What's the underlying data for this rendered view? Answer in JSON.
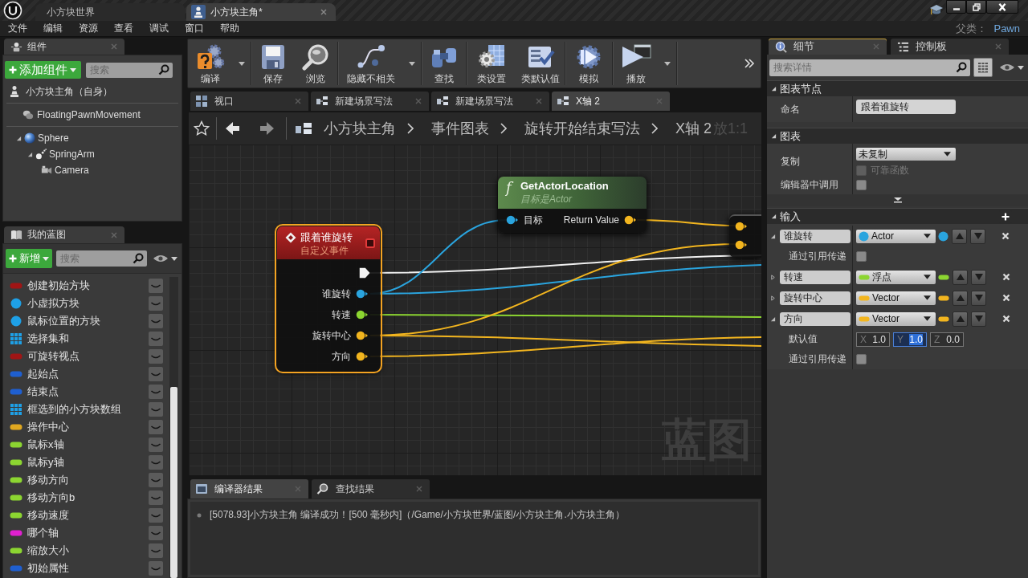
{
  "title_bar": {
    "tabs": [
      {
        "label": "小方块世界",
        "kind": "level",
        "selected": false
      },
      {
        "label": "小方块主角*",
        "kind": "blueprint",
        "selected": true
      }
    ]
  },
  "menu_bar": {
    "items": [
      "文件",
      "编辑",
      "资源",
      "查看",
      "调试",
      "窗口",
      "帮助"
    ],
    "parent_class_label": "父类：",
    "parent_class": "Pawn"
  },
  "components_panel": {
    "tab": "组件",
    "add_button": "添加组件",
    "search": {
      "placeholder": "搜索"
    },
    "root_item": "小方块主角（自身）",
    "components": [
      {
        "label": "FloatingPawnMovement",
        "kind": "movement"
      }
    ],
    "tree": [
      {
        "label": "Sphere",
        "kind": "sphere",
        "expanded": true,
        "children": [
          {
            "label": "SpringArm",
            "kind": "spring_arm",
            "expanded": true,
            "children": [
              {
                "label": "Camera",
                "kind": "camera"
              }
            ]
          }
        ]
      }
    ]
  },
  "my_blueprint_panel": {
    "tab": "我的蓝图",
    "add_button": "新增",
    "search": {
      "placeholder": "搜索"
    },
    "variables": [
      {
        "name": "创建初始方块",
        "kind": "pill",
        "color": "#a01515"
      },
      {
        "name": "小虚拟方块",
        "kind": "sphere",
        "color": "#1ea0e6"
      },
      {
        "name": "鼠标位置的方块",
        "kind": "sphere",
        "color": "#1ea0e6"
      },
      {
        "name": "选择集和",
        "kind": "grid",
        "color": "#1ea0e6"
      },
      {
        "name": "可旋转视点",
        "kind": "pill",
        "color": "#a01515"
      },
      {
        "name": "起始点",
        "kind": "pill",
        "color": "#1f5fd0"
      },
      {
        "name": "结束点",
        "kind": "pill",
        "color": "#1f5fd0"
      },
      {
        "name": "框选到的小方块数组",
        "kind": "grid",
        "color": "#1ea0e6"
      },
      {
        "name": "操作中心",
        "kind": "pill",
        "color": "#e0a820"
      },
      {
        "name": "鼠标x轴",
        "kind": "pill",
        "color": "#8cd531"
      },
      {
        "name": "鼠标y轴",
        "kind": "pill",
        "color": "#8cd531"
      },
      {
        "name": "移动方向",
        "kind": "pill",
        "color": "#8cd531"
      },
      {
        "name": "移动方向b",
        "kind": "pill",
        "color": "#8cd531"
      },
      {
        "name": "移动速度",
        "kind": "pill",
        "color": "#8cd531"
      },
      {
        "name": "哪个轴",
        "kind": "pill",
        "color": "#e020d0"
      },
      {
        "name": "缩放大小",
        "kind": "pill",
        "color": "#8cd531"
      },
      {
        "name": "初始属性",
        "kind": "pill",
        "color": "#1f5fd0"
      }
    ]
  },
  "toolbar": {
    "groups": [
      [
        {
          "label": "编译",
          "kind": "compile",
          "dropdown": true
        }
      ],
      [
        {
          "label": "保存",
          "kind": "save",
          "dropdown": false
        },
        {
          "label": "浏览",
          "kind": "browse",
          "dropdown": false
        }
      ],
      [
        {
          "label": "隐藏不相关",
          "kind": "hide_unrelated",
          "dropdown": true
        }
      ],
      [
        {
          "label": "查找",
          "kind": "find",
          "dropdown": false
        }
      ],
      [
        {
          "label": "类设置",
          "kind": "class_settings",
          "dropdown": false
        },
        {
          "label": "类默认值",
          "kind": "class_defaults",
          "dropdown": false
        }
      ],
      [
        {
          "label": "模拟",
          "kind": "simulate",
          "dropdown": false
        }
      ],
      [
        {
          "label": "播放",
          "kind": "play",
          "dropdown": true
        }
      ]
    ]
  },
  "graph_tabs": [
    {
      "label": "视口",
      "kind": "viewport",
      "selected": false
    },
    {
      "label": "新建场景写法",
      "kind": "graph",
      "selected": false
    },
    {
      "label": "新建场景写法",
      "kind": "graph",
      "selected": false
    },
    {
      "label": "X轴 2",
      "kind": "graph",
      "selected": true
    }
  ],
  "breadcrumb": {
    "items": [
      "小方块主角",
      "事件图表",
      "旋转开始结束写法",
      "X轴 2"
    ],
    "zoom_label": "放1:1"
  },
  "graph": {
    "nodes": [
      {
        "kind": "custom_event",
        "title": "跟着谁旋转",
        "subtitle": "自定义事件",
        "selected": true,
        "outputs": [
          {
            "kind": "exec",
            "connected": true
          },
          {
            "kind": "data",
            "label": "谁旋转",
            "color": "#2aa4de",
            "connected": true
          },
          {
            "kind": "data",
            "label": "转速",
            "color": "#8cd531",
            "connected": true
          },
          {
            "kind": "data",
            "label": "旋转中心",
            "color": "#f2b51f",
            "connected": true
          },
          {
            "kind": "data",
            "label": "方向",
            "color": "#f2b51f",
            "connected": true
          }
        ]
      },
      {
        "kind": "function",
        "icon": "f",
        "title": "GetActorLocation",
        "subtitle": "目标是Actor",
        "selected": false,
        "inputs": [
          {
            "kind": "data",
            "label": "目标",
            "color": "#2aa4de",
            "connected": true
          }
        ],
        "outputs": [
          {
            "kind": "data",
            "label": "Return Value",
            "color": "#f2b51f",
            "connected": true
          }
        ]
      },
      {
        "kind": "partial",
        "selected": false,
        "inputs": [
          {
            "kind": "data",
            "color": "#f2b51f",
            "connected": true
          },
          {
            "kind": "data",
            "color": "#f2b51f",
            "connected": true
          }
        ]
      }
    ],
    "watermark": "蓝图"
  },
  "output_panel": {
    "tabs": [
      {
        "label": "编译器结果",
        "kind": "compiler",
        "selected": true
      },
      {
        "label": "查找结果",
        "kind": "find",
        "selected": false
      }
    ],
    "messages": [
      "[5078.93]小方块主角 编译成功！[500 毫秒内]（/Game/小方块世界/蓝图/小方块主角.小方块主角）"
    ]
  },
  "details_panel": {
    "tabs": [
      {
        "label": "细节",
        "kind": "details",
        "selected": true
      },
      {
        "label": "控制板",
        "kind": "palette",
        "selected": false
      }
    ],
    "search": {
      "placeholder": "搜索详情"
    },
    "graph_node_section": {
      "title": "图表节点",
      "expanded": true,
      "name_label": "命名",
      "name_value": "跟着谁旋转"
    },
    "graph_section": {
      "title": "图表",
      "expanded": true,
      "replication_label": "复制",
      "replication_value": "未复制",
      "reliable": {
        "label": "可靠函数",
        "checked": false,
        "disabled": true
      },
      "call_in_editor": {
        "label": "编辑器中调用",
        "checked": false,
        "disabled": false
      }
    },
    "inputs_section": {
      "title": "输入",
      "expanded": true,
      "params": [
        {
          "name": "谁旋转",
          "expanded": true,
          "type": "Actor",
          "kind": "object",
          "color": "#2aa4de",
          "pass_by_ref": {
            "label": "通过引用传递",
            "checked": false,
            "disabled": false
          }
        },
        {
          "name": "转速",
          "expanded": false,
          "type": "浮点",
          "kind": "value",
          "color": "#8cd531"
        },
        {
          "name": "旋转中心",
          "expanded": false,
          "type": "Vector",
          "kind": "value",
          "color": "#f2b51f"
        },
        {
          "name": "方向",
          "expanded": true,
          "type": "Vector",
          "kind": "value",
          "color": "#f2b51f",
          "default_label": "默认值",
          "default_value": [
            {
              "axis": "X",
              "value": "1.0",
              "focused": false
            },
            {
              "axis": "Y",
              "value": "1.0",
              "focused": true
            },
            {
              "axis": "Z",
              "value": "0.0",
              "focused": false
            }
          ],
          "pass_by_ref": {
            "label": "通过引用传递",
            "checked": false,
            "disabled": false
          }
        }
      ]
    }
  }
}
